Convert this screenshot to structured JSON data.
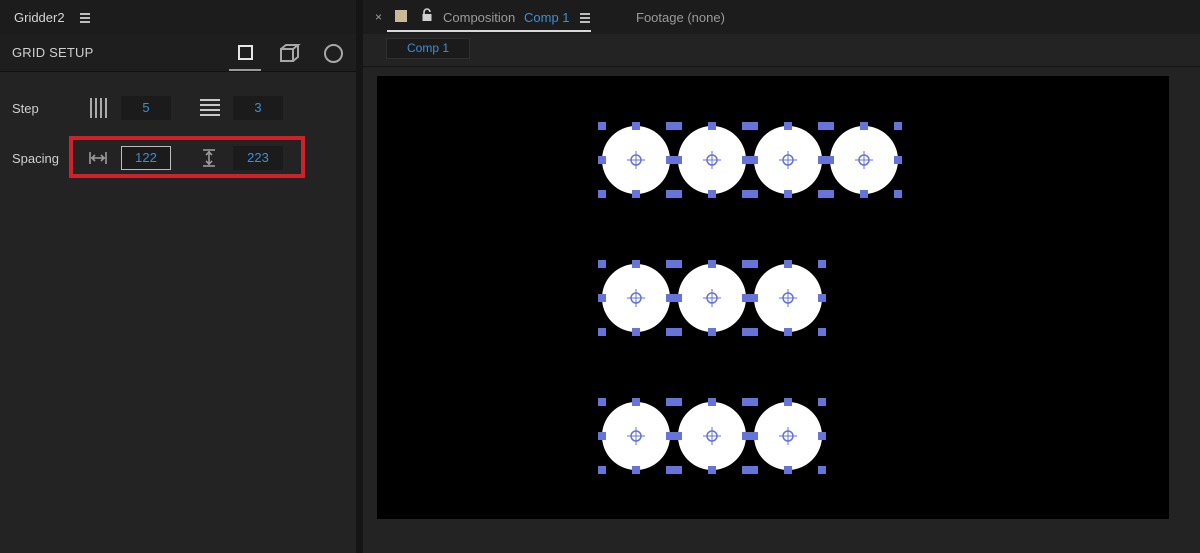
{
  "left_panel": {
    "title": "Gridder2",
    "section_title": "GRID SETUP",
    "modes": [
      "square-icon",
      "cube-icon",
      "circle-icon"
    ],
    "step": {
      "label": "Step",
      "columns_value": "5",
      "rows_value": "3"
    },
    "spacing": {
      "label": "Spacing",
      "horizontal_value": "122",
      "vertical_value": "223"
    }
  },
  "composition_panel": {
    "close_glyph": "×",
    "tab_prefix": "Composition",
    "tab_comp_name": "Comp 1",
    "footage_tab": "Footage (none)",
    "subtab_label": "Comp 1"
  },
  "canvas": {
    "background": "#000000",
    "circle_fill": "#ffffff",
    "handle_color": "#6673d8",
    "rows": [
      4,
      3,
      3
    ]
  },
  "colors": {
    "accent": "#3b8ed8",
    "highlight": "#d0202a"
  }
}
